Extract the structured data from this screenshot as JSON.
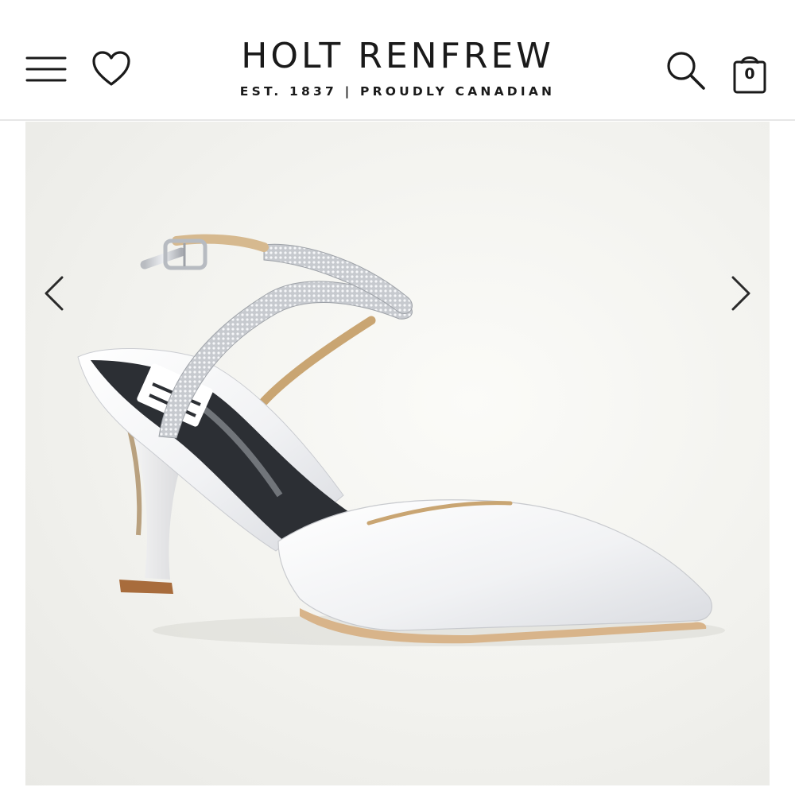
{
  "header": {
    "brand_name": "HOLT RENFREW",
    "brand_tagline": "EST. 1837 | PROUDLY CANADIAN",
    "bag_count": "0",
    "icons": {
      "menu": "hamburger-menu-icon",
      "wishlist": "heart-icon",
      "search": "search-icon",
      "bag": "shopping-bag-icon"
    }
  },
  "gallery": {
    "image_subject": "white satin pointed-toe pump with crystal ankle strap",
    "prev_icon": "chevron-left-icon",
    "next_icon": "chevron-right-icon"
  },
  "colors": {
    "text": "#1a1a1a",
    "background": "#ffffff",
    "header_divider": "#e6e6e6",
    "gallery_background": "#f2f2ee"
  }
}
